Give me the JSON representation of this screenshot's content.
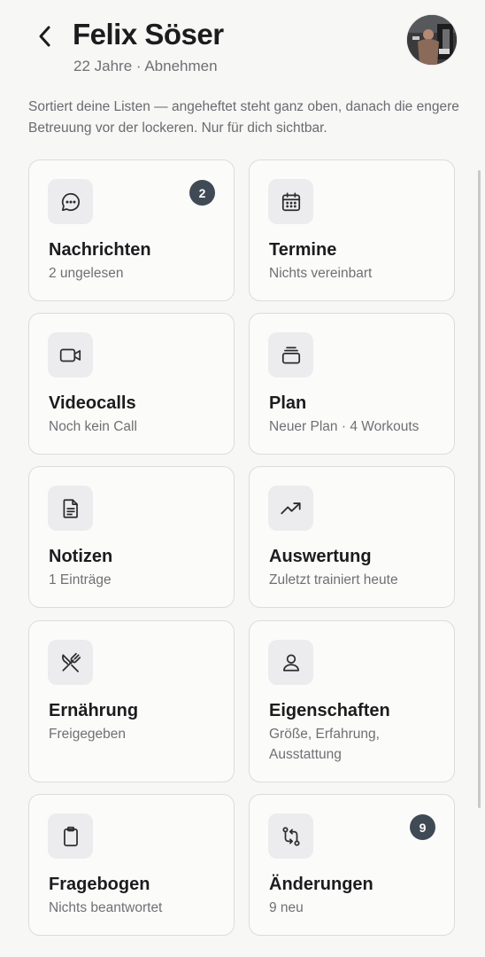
{
  "header": {
    "name": "Felix Söser",
    "subtitle": "22 Jahre · Abnehmen"
  },
  "description": "Sortiert deine Listen — angeheftet steht ganz oben, danach die engere Betreuung vor der lockeren. Nur für dich sichtbar.",
  "colors": {
    "background": "#f7f7f6",
    "badge": "#3f4a55",
    "icon_tile": "#ececee"
  },
  "cards": [
    {
      "key": "messages",
      "title": "Nachrichten",
      "subtitle": "2 ungelesen",
      "icon": "chat-bubble-icon",
      "badge": "2"
    },
    {
      "key": "appointments",
      "title": "Termine",
      "subtitle": "Nichts vereinbart",
      "icon": "calendar-icon"
    },
    {
      "key": "videocalls",
      "title": "Videocalls",
      "subtitle": "Noch kein Call",
      "icon": "video-camera-icon"
    },
    {
      "key": "plan",
      "title": "Plan",
      "subtitle": "Neuer Plan · 4 Workouts",
      "icon": "stack-icon"
    },
    {
      "key": "notes",
      "title": "Notizen",
      "subtitle": "1 Einträge",
      "icon": "document-icon"
    },
    {
      "key": "analysis",
      "title": "Auswertung",
      "subtitle": "Zuletzt trainiert heute",
      "icon": "trending-up-icon"
    },
    {
      "key": "nutrition",
      "title": "Ernährung",
      "subtitle": "Freigegeben",
      "icon": "fork-knife-icon"
    },
    {
      "key": "properties",
      "title": "Eigenschaften",
      "subtitle": "Größe, Erfahrung, Ausstattung",
      "icon": "person-icon"
    },
    {
      "key": "questionnaire",
      "title": "Fragebogen",
      "subtitle": "Nichts beantwortet",
      "icon": "clipboard-icon"
    },
    {
      "key": "changes",
      "title": "Änderungen",
      "subtitle": "9 neu",
      "icon": "compare-arrows-icon",
      "badge": "9"
    }
  ]
}
